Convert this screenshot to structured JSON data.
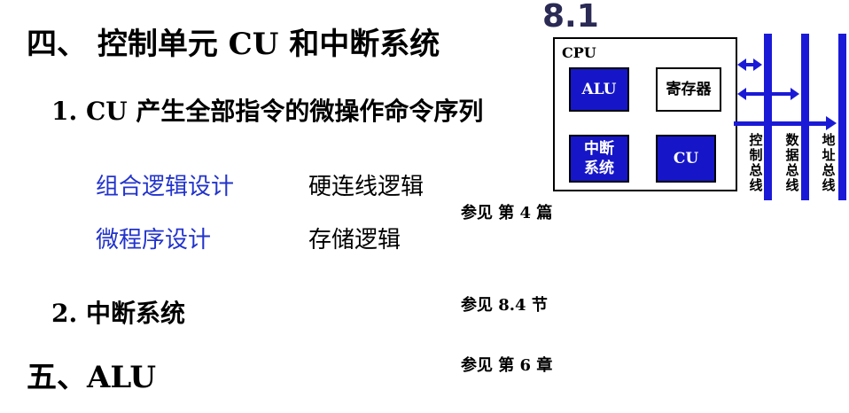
{
  "heading1": "四、 控制单元 CU 和中断系统",
  "point1": "1.  CU    产生全部指令的微操作命令序列",
  "methods": [
    {
      "name": "组合逻辑设计",
      "impl": "硬连线逻辑"
    },
    {
      "name": "微程序设计",
      "impl": "存储逻辑"
    }
  ],
  "ref1": "参见  第 4 篇",
  "point2": "2.  中断系统",
  "ref2": "参见   8.4 节",
  "heading2": "五、ALU",
  "ref3": "参见  第 6 章",
  "diagram": {
    "section_number": "8.1",
    "cpu_label": "CPU",
    "alu": "ALU",
    "registers": "寄存器",
    "interrupt": "中断\n系统",
    "cu": "CU",
    "buses": [
      "控制总线",
      "数据总线",
      "地址总线"
    ],
    "bus_color": "#1a1ad6",
    "block_color": "#1616c8"
  }
}
